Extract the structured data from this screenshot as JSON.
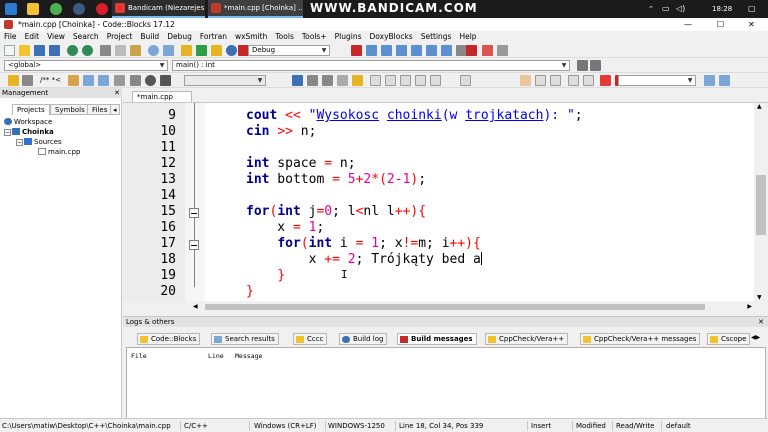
{
  "taskbar": {
    "tasks": [
      {
        "label": "Bandicam (Niezarejes...",
        "active": false
      },
      {
        "label": "*main.cpp [Choinka] ...",
        "active": true
      }
    ],
    "watermark": "WWW.BANDICAM.COM",
    "clock": "18:28"
  },
  "window": {
    "title": "*main.cpp [Choinka] - Code::Blocks 17.12",
    "controls": [
      "—",
      "☐",
      "✕"
    ]
  },
  "menu": [
    "File",
    "Edit",
    "View",
    "Search",
    "Project",
    "Build",
    "Debug",
    "Fortran",
    "wxSmith",
    "Tools",
    "Tools+",
    "Plugins",
    "DoxyBlocks",
    "Settings",
    "Help"
  ],
  "toolbar": {
    "build_target": "Debug",
    "scope": "<global>",
    "function": "main() : int",
    "doxy_label": "/** *<"
  },
  "management": {
    "title": "Management",
    "tabs": [
      "Projects",
      "Symbols",
      "Files"
    ],
    "tree": {
      "workspace": "Workspace",
      "project": "Choinka",
      "folder": "Sources",
      "file": "main.cpp"
    }
  },
  "editor": {
    "tab_label": "*main.cpp",
    "lines": [
      {
        "num": "9",
        "text": "cout << \"Wysokosc choinki(w trojkatach): \";"
      },
      {
        "num": "10",
        "text": "cin >> n;"
      },
      {
        "num": "11",
        "text": ""
      },
      {
        "num": "12",
        "text": "int space = n;"
      },
      {
        "num": "13",
        "text": "int bottom = 5+2*(2-1);"
      },
      {
        "num": "14",
        "text": ""
      },
      {
        "num": "15",
        "text": "for(int j=0; l<nl l++){"
      },
      {
        "num": "16",
        "text": "x = 1;"
      },
      {
        "num": "17",
        "text": "for(int i = 1; x!=m; i++){"
      },
      {
        "num": "18",
        "text": "x += 2; Trójkąty bed a"
      },
      {
        "num": "19",
        "text": "}"
      },
      {
        "num": "20",
        "text": "}"
      }
    ]
  },
  "logs": {
    "title": "Logs & others",
    "tabs": [
      "Code::Blocks",
      "Search results",
      "Cccc",
      "Build log",
      "Build messages",
      "CppCheck/Vera++",
      "CppCheck/Vera++ messages",
      "Cscope"
    ],
    "active_tab": "Build messages",
    "columns": [
      "File",
      "Line",
      "Message"
    ]
  },
  "statusbar": {
    "path": "C:\\Users\\matiw\\Desktop\\C++\\Choinka\\main.cpp",
    "language": "C/C++",
    "eol": "Windows (CR+LF)",
    "encoding": "WINDOWS-1250",
    "position": "Line 18, Col 34, Pos 339",
    "mode": "Insert",
    "modified": "Modified",
    "access": "Read/Write",
    "profile": "default"
  },
  "colors": {
    "keyword": "#00008b",
    "string": "#0000ff",
    "number": "#f0008f",
    "operator": "#ff0000"
  }
}
